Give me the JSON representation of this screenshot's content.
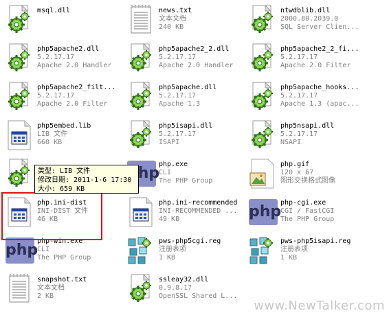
{
  "files": [
    {
      "name": "msql.dll",
      "meta": [],
      "icon": "dll-gear-icon",
      "col": 0,
      "row": 0
    },
    {
      "name": "news.txt",
      "meta": [
        "文本文档",
        "240 KB"
      ],
      "icon": "text-document-icon",
      "col": 1,
      "row": 0
    },
    {
      "name": "ntwdblib.dll",
      "meta": [
        "2000.80.2039.0",
        "SQL Server Clien..."
      ],
      "icon": "dll-gear-icon",
      "col": 2,
      "row": 0
    },
    {
      "name": "php5apache2.dll",
      "meta": [
        "5.2.17.17",
        "Apache 2.0 Handler"
      ],
      "icon": "dll-gear-icon",
      "col": 0,
      "row": 1
    },
    {
      "name": "php5apache2_2.dll",
      "meta": [
        "5.2.17.17",
        "Apache 2.0 Handler"
      ],
      "icon": "dll-gear-icon",
      "col": 1,
      "row": 1
    },
    {
      "name": "php5apache2_2_fi...",
      "meta": [
        "5.2.17.17",
        "Apache 2.0 Filter"
      ],
      "icon": "dll-gear-icon",
      "col": 2,
      "row": 1
    },
    {
      "name": "php5apache2_filt...",
      "meta": [
        "5.2.17.17",
        "Apache 2.0 Filter"
      ],
      "icon": "dll-gear-icon",
      "col": 0,
      "row": 2
    },
    {
      "name": "php5apache.dll",
      "meta": [
        "5.2.17.17",
        "Apache 1.3"
      ],
      "icon": "dll-gear-icon",
      "col": 1,
      "row": 2
    },
    {
      "name": "php5apache_hooks...",
      "meta": [
        "5.2.17.17",
        "Apache 1.3 (apac..."
      ],
      "icon": "dll-gear-icon",
      "col": 2,
      "row": 2
    },
    {
      "name": "php5embed.lib",
      "meta": [
        "LIB 文件",
        "660 KB"
      ],
      "icon": "generic-file-icon",
      "col": 0,
      "row": 3
    },
    {
      "name": "php5isapi.dll",
      "meta": [
        "5.2.17.17",
        "ISAPI"
      ],
      "icon": "dll-gear-icon",
      "col": 1,
      "row": 3
    },
    {
      "name": "php5nsapi.dll",
      "meta": [
        "5.2.17.17",
        "NSAPI"
      ],
      "icon": "dll-gear-icon",
      "col": 2,
      "row": 3
    },
    {
      "name": "",
      "meta": [],
      "icon": "dll-gear-icon",
      "col": 0,
      "row": 4
    },
    {
      "name": "php.exe",
      "meta": [
        "CLI",
        "The PHP Group"
      ],
      "icon": "php-exe-icon",
      "col": 1,
      "row": 4
    },
    {
      "name": "php.gif",
      "meta": [
        "120 x 67",
        "图形交换格式图像"
      ],
      "icon": "image-file-icon",
      "col": 2,
      "row": 4
    },
    {
      "name": "php.ini-dist",
      "meta": [
        "INI-DIST 文件",
        "46 KB"
      ],
      "icon": "generic-file-icon",
      "col": 0,
      "row": 5
    },
    {
      "name": "php.ini-recommended",
      "meta": [
        "INI-RECOMMENDED ...",
        "49 KB"
      ],
      "icon": "generic-file-icon",
      "col": 1,
      "row": 5
    },
    {
      "name": "php-cgi.exe",
      "meta": [
        "CGI / FastCGI",
        "The PHP Group"
      ],
      "icon": "php-exe-icon",
      "col": 2,
      "row": 5
    },
    {
      "name": "php-win.exe",
      "meta": [
        "CLI",
        "The PHP Group"
      ],
      "icon": "php-exe-icon",
      "col": 0,
      "row": 6
    },
    {
      "name": "pws-php5cgi.reg",
      "meta": [
        "注册表项",
        "1 KB"
      ],
      "icon": "registry-file-icon",
      "col": 1,
      "row": 6
    },
    {
      "name": "pws-php5isapi.reg",
      "meta": [
        "注册表项",
        "1 KB"
      ],
      "icon": "registry-file-icon",
      "col": 2,
      "row": 6
    },
    {
      "name": "snapshot.txt",
      "meta": [
        "文本文档",
        "2 KB"
      ],
      "icon": "text-document-icon",
      "col": 0,
      "row": 7
    },
    {
      "name": "ssleay32.dll",
      "meta": [
        "0.9.8.17",
        "OpenSSL Shared L..."
      ],
      "icon": "dll-gear-icon",
      "col": 1,
      "row": 7
    }
  ],
  "tooltip": {
    "line1": "类型: LIB 文件",
    "line2": "修改日期: 2011-1-6 17:30",
    "line3": "大小: 659 KB"
  },
  "php_logo_text": "php",
  "watermark": "www.NewTalker.com",
  "colors": {
    "highlight": "#e01010",
    "tooltip_bg": "#ffffe1",
    "meta_text": "#808080"
  }
}
